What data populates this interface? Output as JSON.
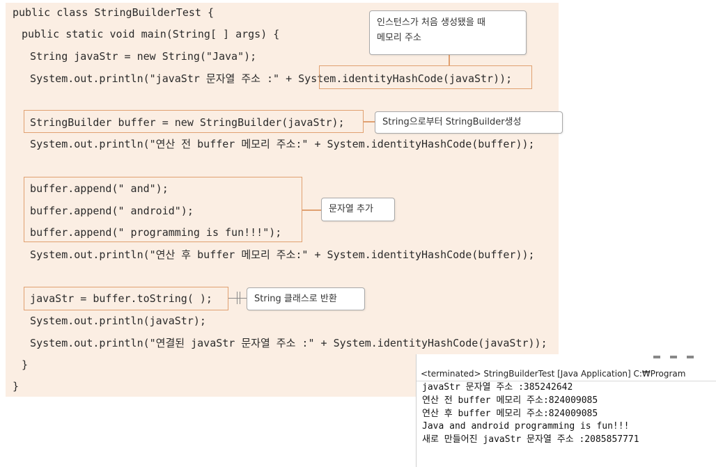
{
  "code": {
    "lines": [
      "public class StringBuilderTest {",
      " public static void main(String[ ] args) {",
      "  String javaStr = new String(\"Java\");",
      "  System.out.println(\"javaStr 문자열 주소 :\" + System.identityHashCode(javaStr));",
      "",
      "  StringBuilder buffer = new StringBuilder(javaStr);",
      "  System.out.println(\"연산 전 buffer 메모리 주소:\" + System.identityHashCode(buffer));",
      "",
      "  buffer.append(\" and\");",
      "  buffer.append(\" android\");",
      "  buffer.append(\" programming is fun!!!\");",
      "  System.out.println(\"연산 후 buffer 메모리 주소:\" + System.identityHashCode(buffer));",
      "",
      "  javaStr = buffer.toString( );",
      "  System.out.println(javaStr);",
      "  System.out.println(\"연결된 javaStr 문자열 주소 :\" + System.identityHashCode(javaStr));",
      " }",
      "}"
    ]
  },
  "callouts": {
    "first_creation": [
      "인스턴스가 처음 생성됐을 때",
      "메모리 주소"
    ],
    "builder_from_string": "String으로부터 StringBuilder생성",
    "append": "문자열 추가",
    "to_string": "String 클래스로 반환"
  },
  "console": {
    "title": "<terminated> StringBuilderTest [Java Application] C:₩Program",
    "lines": [
      "javaStr 문자열 주소 :385242642",
      "연산 전 buffer 메모리 주소:824009085",
      "연산 후 buffer 메모리 주소:824009085",
      "Java and android programming is fun!!!",
      "새로 만들어진 javaStr 문자열 주소 :2085857771"
    ]
  },
  "colors": {
    "panel_background": "#fbeee3",
    "highlight_border": "#e0a070"
  }
}
